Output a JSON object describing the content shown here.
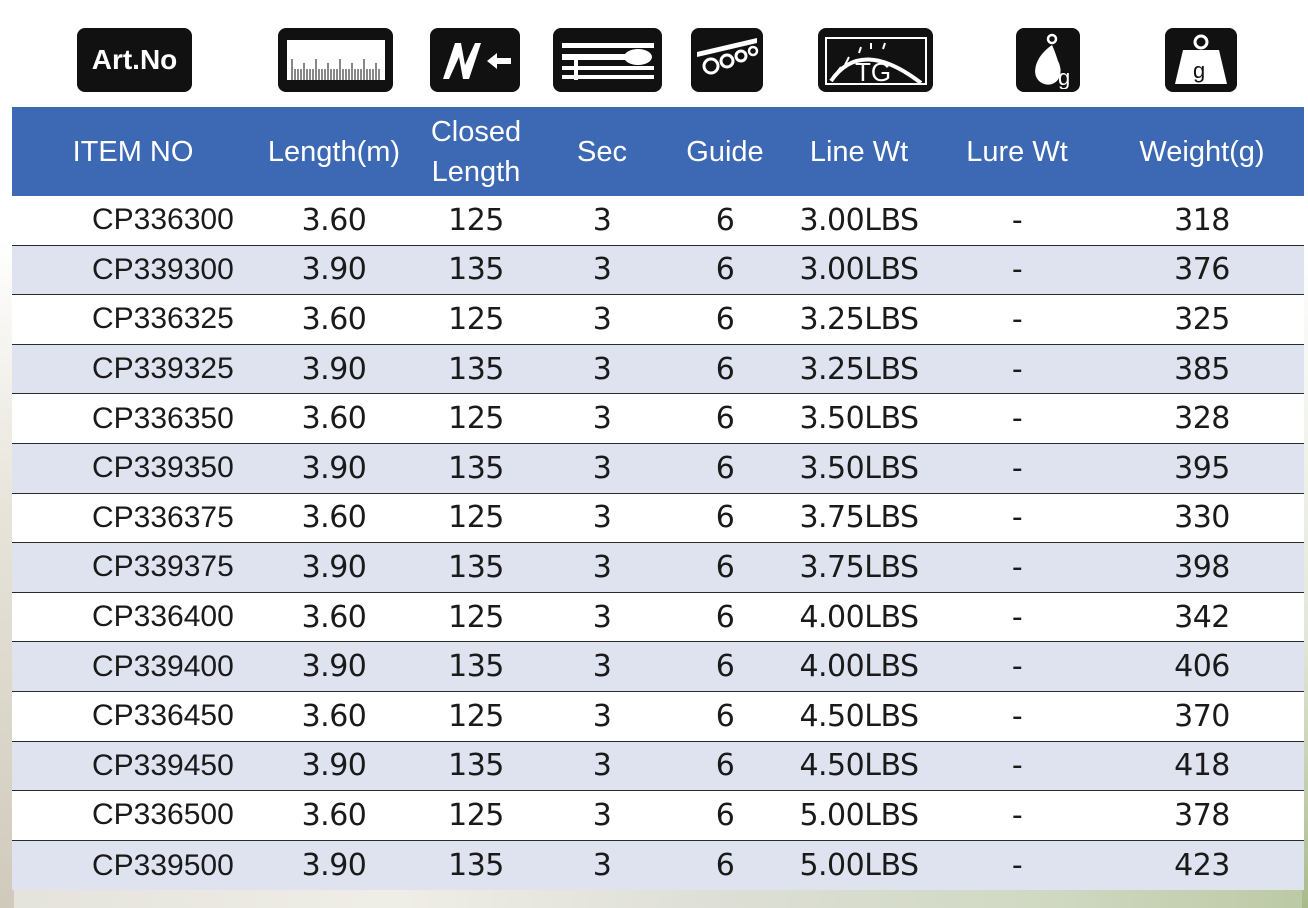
{
  "icons": {
    "art_no_label": "Art.No",
    "length_icon": "ruler-icon",
    "closed_length_icon": "closed-length-icon",
    "sections_icon": "rod-sections-icon",
    "guide_icon": "rod-guides-icon",
    "line_wt_icon": "test-curve-tg-icon",
    "tg_label": "TG",
    "lure_wt_icon": "lure-weight-icon",
    "lure_g_label": "g",
    "weight_icon": "weight-icon",
    "weight_g_label": "g"
  },
  "table": {
    "headers": {
      "item_no": "ITEM NO",
      "length": "Length(m)",
      "closed_line1": "Closed",
      "closed_line2": "Length",
      "sec": "Sec",
      "guide": "Guide",
      "line_wt": "Line Wt",
      "lure_wt": "Lure Wt",
      "weight": "Weight(g)"
    },
    "rows": [
      {
        "item": "CP336300",
        "length": "3.60",
        "closed": "125",
        "sec": "3",
        "guide": "6",
        "line_wt": "3.00LBS",
        "lure_wt": "-",
        "weight": "318"
      },
      {
        "item": "CP339300",
        "length": "3.90",
        "closed": "135",
        "sec": "3",
        "guide": "6",
        "line_wt": "3.00LBS",
        "lure_wt": "-",
        "weight": "376"
      },
      {
        "item": "CP336325",
        "length": "3.60",
        "closed": "125",
        "sec": "3",
        "guide": "6",
        "line_wt": "3.25LBS",
        "lure_wt": "-",
        "weight": "325"
      },
      {
        "item": "CP339325",
        "length": "3.90",
        "closed": "135",
        "sec": "3",
        "guide": "6",
        "line_wt": "3.25LBS",
        "lure_wt": "-",
        "weight": "385"
      },
      {
        "item": "CP336350",
        "length": "3.60",
        "closed": "125",
        "sec": "3",
        "guide": "6",
        "line_wt": "3.50LBS",
        "lure_wt": "-",
        "weight": "328"
      },
      {
        "item": "CP339350",
        "length": "3.90",
        "closed": "135",
        "sec": "3",
        "guide": "6",
        "line_wt": "3.50LBS",
        "lure_wt": "-",
        "weight": "395"
      },
      {
        "item": "CP336375",
        "length": "3.60",
        "closed": "125",
        "sec": "3",
        "guide": "6",
        "line_wt": "3.75LBS",
        "lure_wt": "-",
        "weight": "330"
      },
      {
        "item": "CP339375",
        "length": "3.90",
        "closed": "135",
        "sec": "3",
        "guide": "6",
        "line_wt": "3.75LBS",
        "lure_wt": "-",
        "weight": "398"
      },
      {
        "item": "CP336400",
        "length": "3.60",
        "closed": "125",
        "sec": "3",
        "guide": "6",
        "line_wt": "4.00LBS",
        "lure_wt": "-",
        "weight": "342"
      },
      {
        "item": "CP339400",
        "length": "3.90",
        "closed": "135",
        "sec": "3",
        "guide": "6",
        "line_wt": "4.00LBS",
        "lure_wt": "-",
        "weight": "406"
      },
      {
        "item": "CP336450",
        "length": "3.60",
        "closed": "125",
        "sec": "3",
        "guide": "6",
        "line_wt": "4.50LBS",
        "lure_wt": "-",
        "weight": "370"
      },
      {
        "item": "CP339450",
        "length": "3.90",
        "closed": "135",
        "sec": "3",
        "guide": "6",
        "line_wt": "4.50LBS",
        "lure_wt": "-",
        "weight": "418"
      },
      {
        "item": "CP336500",
        "length": "3.60",
        "closed": "125",
        "sec": "3",
        "guide": "6",
        "line_wt": "5.00LBS",
        "lure_wt": "-",
        "weight": "378"
      },
      {
        "item": "CP339500",
        "length": "3.90",
        "closed": "135",
        "sec": "3",
        "guide": "6",
        "line_wt": "5.00LBS",
        "lure_wt": "-",
        "weight": "423"
      }
    ]
  },
  "colors": {
    "header_bg": "#3d69b4",
    "row_alt_bg": "#dfe3f0",
    "icon_bg": "#111111"
  }
}
